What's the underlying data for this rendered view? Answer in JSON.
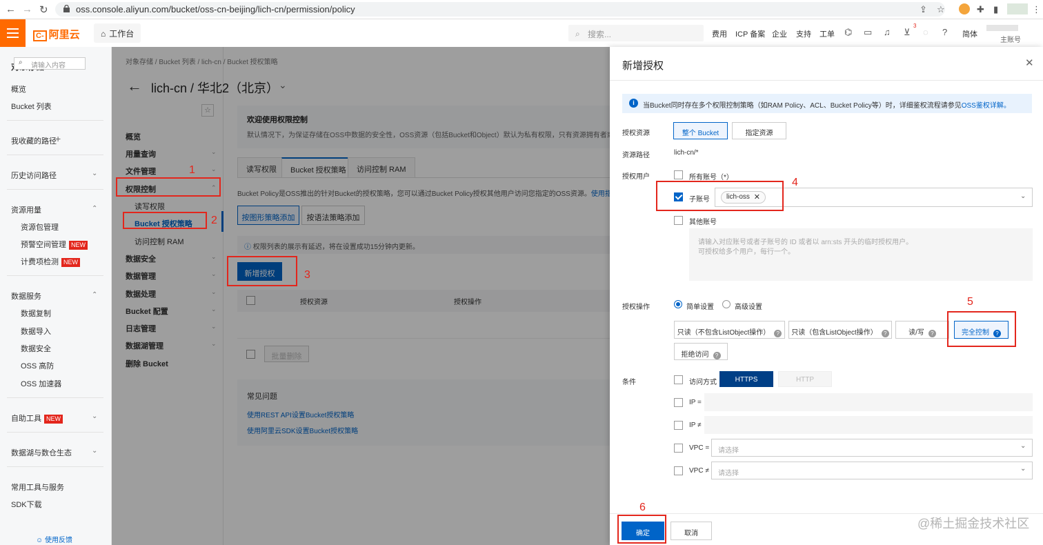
{
  "browser": {
    "url": "oss.console.aliyun.com/bucket/oss-cn-beijing/lich-cn/permission/policy"
  },
  "top": {
    "logo": "阿里云",
    "workbench": "工作台",
    "search_placeholder": "搜索...",
    "links": [
      "费用",
      "ICP 备案",
      "企业",
      "支持",
      "工单"
    ],
    "cart_badge": "3",
    "lang": "简体",
    "account": "主账号"
  },
  "sidebar": {
    "title": "对象存储 OSS",
    "overview": "概览",
    "bucket_list": "Bucket 列表",
    "favorites": "我收藏的路径",
    "history": "历史访问路径",
    "resources": "资源用量",
    "resource_items": [
      "资源包管理",
      "预警空间管理",
      "计费项检测"
    ],
    "new": "NEW",
    "data_services": "数据服务",
    "data_items": [
      "数据复制",
      "数据导入",
      "数据安全",
      "OSS 高防",
      "OSS 加速器"
    ],
    "self_tools": "自助工具",
    "datalake": "数据湖与数仓生态",
    "common_tools": "常用工具与服务",
    "sdk": "SDK下载",
    "feedback": "使用反馈"
  },
  "nav2": {
    "search_placeholder": "请输入内容",
    "items": [
      "概览",
      "用量查询",
      "文件管理",
      "权限控制",
      "读写权限",
      "Bucket 授权策略",
      "访问控制 RAM",
      "数据安全",
      "数据管理",
      "数据处理",
      "Bucket 配置",
      "日志管理",
      "数据湖管理",
      "删除 Bucket"
    ]
  },
  "main": {
    "breadcrumb": [
      "对象存储",
      "Bucket 列表",
      "lich-cn",
      "Bucket 授权策略"
    ],
    "title": "lich-cn / 华北2（北京）",
    "welcome_title": "欢迎使用权限控制",
    "welcome_desc": "默认情况下，为保证存储在OSS中数据的安全性，OSS资源（包括Bucket和Object）默认为私有权限，只有资源拥有者或者被授",
    "tabs": [
      "读写权限",
      "Bucket 授权策略",
      "访问控制 RAM"
    ],
    "policy_desc": "Bucket Policy是OSS推出的针对Bucket的授权策略，您可以通过Bucket Policy授权其他用户访问您指定的OSS资源。",
    "policy_link": "使用指南",
    "btn_graphic": "按图形策略添加",
    "btn_syntax": "按语法策略添加",
    "info": "权限列表的展示有延迟，将在设置成功15分钟内更新。",
    "btn_add": "新增授权",
    "col_resource": "授权资源",
    "col_action": "授权操作",
    "btn_batch_delete": "批量删除",
    "faq_title": "常见问题",
    "faq_links": [
      "使用REST API设置Bucket授权策略",
      "使用阿里云SDK设置Bucket授权策略"
    ]
  },
  "annotations": [
    "1",
    "2",
    "3",
    "4",
    "5",
    "6"
  ],
  "drawer": {
    "title": "新增授权",
    "note": "当Bucket同时存在多个权限控制策略（如RAM Policy、ACL、Bucket Policy等）时，详细鉴权流程请参见",
    "note_link": "OSS鉴权详解。",
    "resource_label": "授权资源",
    "resource_options": [
      "整个 Bucket",
      "指定资源"
    ],
    "path_label": "资源路径",
    "path_value": "lich-cn/*",
    "user_label": "授权用户",
    "all_accounts": "所有账号（*）",
    "sub_account": "子账号",
    "sub_tag": "lich-oss",
    "other_account": "其他账号",
    "other_placeholder_1": "请输入对应账号或者子账号的 ID 或者以 arn:sts 开头的临时授权用户。",
    "other_placeholder_2": "可授权给多个用户，每行一个。",
    "action_label": "授权操作",
    "simple": "简单设置",
    "advanced": "高级设置",
    "actions": [
      "只读（不包含ListObject操作）",
      "只读（包含ListObject操作）",
      "读/写",
      "完全控制",
      "拒绝访问"
    ],
    "cond_label": "条件",
    "access_mode": "访问方式",
    "https": "HTTPS",
    "http": "HTTP",
    "ip_eq": "IP =",
    "ip_ne": "IP ≠",
    "vpc_eq": "VPC =",
    "vpc_ne": "VPC ≠",
    "select_placeholder": "请选择",
    "ok": "确定",
    "cancel": "取消"
  },
  "watermark": "@稀土掘金技术社区"
}
